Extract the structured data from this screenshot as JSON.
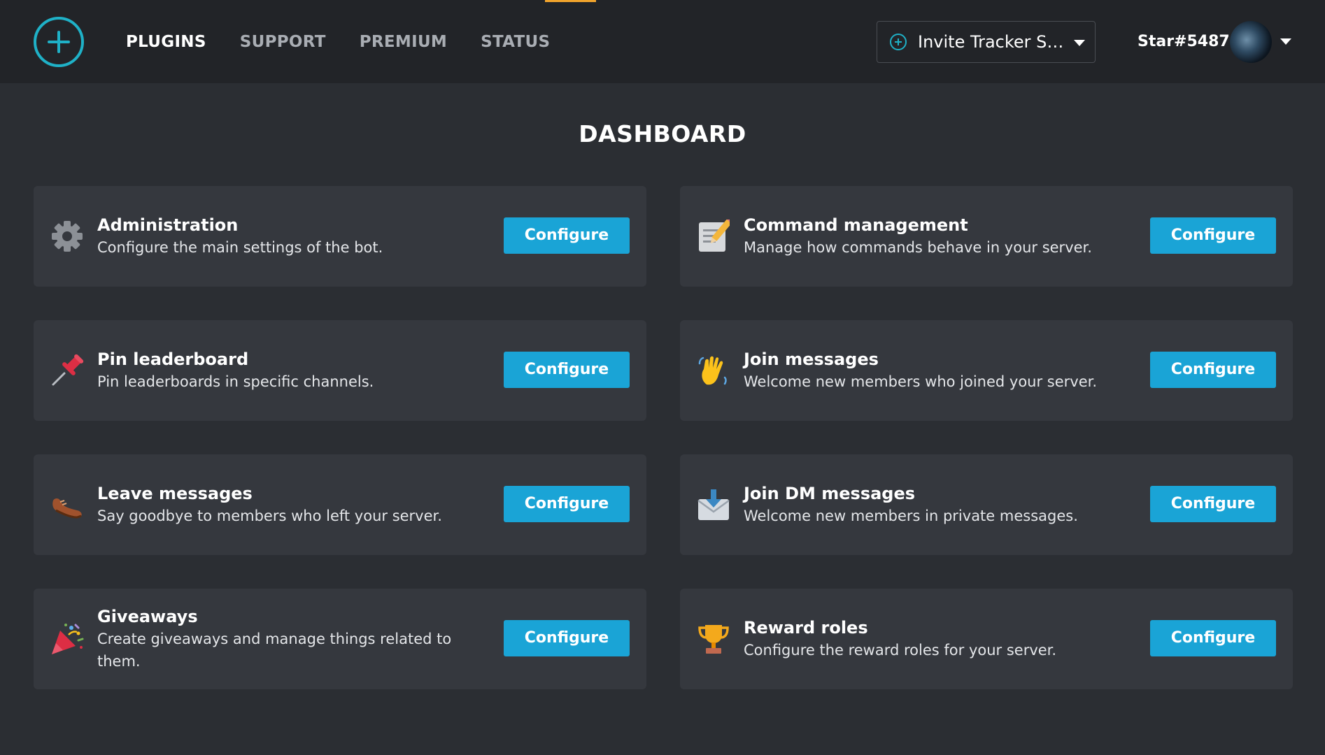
{
  "header": {
    "nav": [
      {
        "label": "PLUGINS",
        "active": true
      },
      {
        "label": "SUPPORT",
        "active": false
      },
      {
        "label": "PREMIUM",
        "active": false
      },
      {
        "label": "STATUS",
        "active": false
      }
    ],
    "server_select": {
      "label": "Invite Tracker Su..."
    },
    "user": {
      "name": "Star#5487"
    }
  },
  "main": {
    "title": "DASHBOARD",
    "plugins": [
      {
        "icon": "gear-icon",
        "title": "Administration",
        "description": "Configure the main settings of the bot.",
        "button": "Configure"
      },
      {
        "icon": "memo-icon",
        "title": "Command management",
        "description": "Manage how commands behave in your server.",
        "button": "Configure"
      },
      {
        "icon": "pushpin-icon",
        "title": "Pin leaderboard",
        "description": "Pin leaderboards in specific channels.",
        "button": "Configure"
      },
      {
        "icon": "waving-hand-icon",
        "title": "Join messages",
        "description": "Welcome new members who joined your server.",
        "button": "Configure"
      },
      {
        "icon": "shoe-icon",
        "title": "Leave messages",
        "description": "Say goodbye to members who left your server.",
        "button": "Configure"
      },
      {
        "icon": "inbox-envelope-icon",
        "title": "Join DM messages",
        "description": "Welcome new members in private messages.",
        "button": "Configure"
      },
      {
        "icon": "party-popper-icon",
        "title": "Giveaways",
        "description": "Create giveaways and manage things related to them.",
        "button": "Configure"
      },
      {
        "icon": "trophy-icon",
        "title": "Reward roles",
        "description": "Configure the reward roles for your server.",
        "button": "Configure"
      }
    ]
  },
  "colors": {
    "background": "#2b2e33",
    "header": "#222428",
    "card": "#35383e",
    "accent": "#1fb1c7",
    "button": "#1aa4d6",
    "tab_indicator": "#f0a32c"
  }
}
